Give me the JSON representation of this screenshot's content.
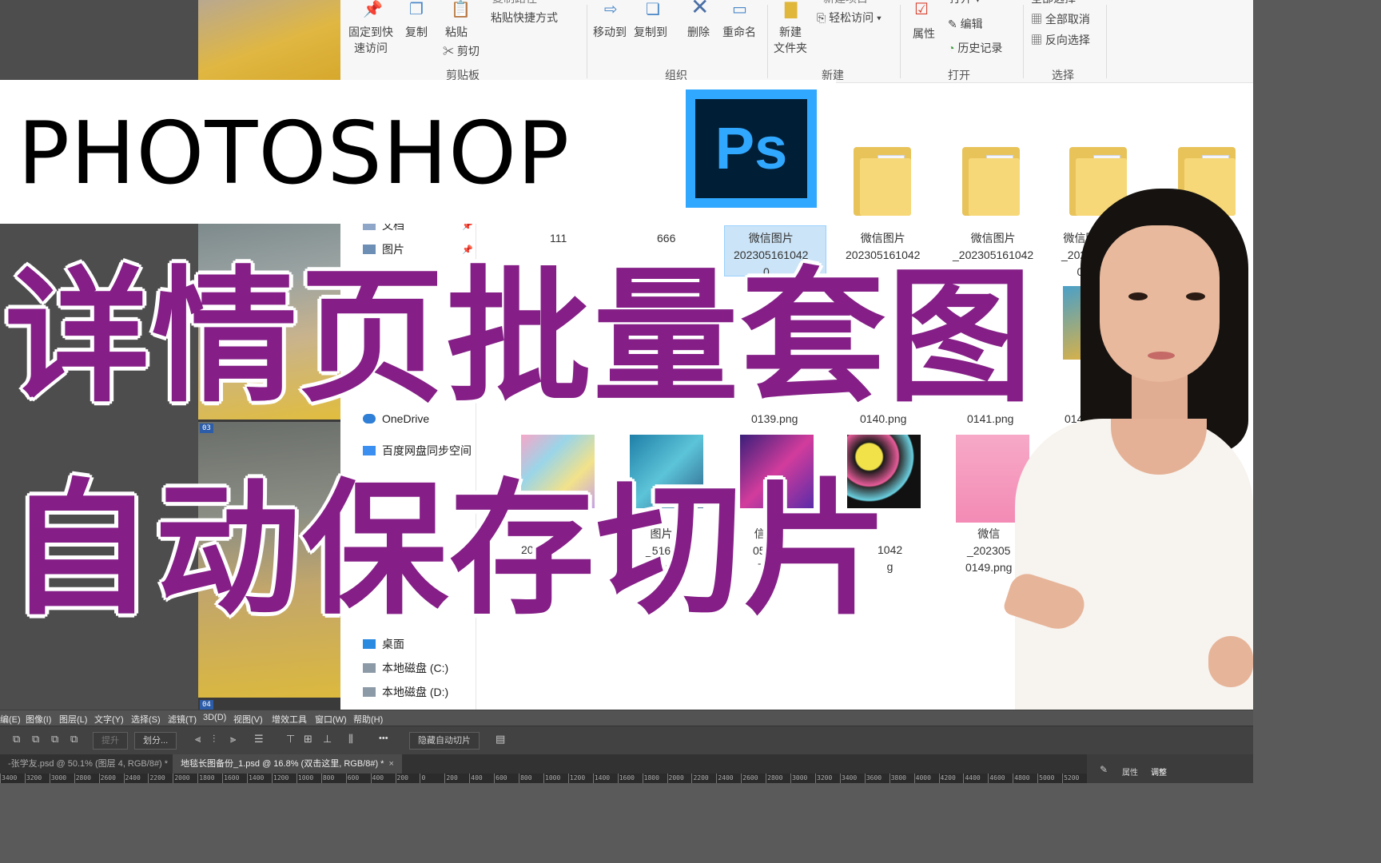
{
  "overlay": {
    "title_en": "PHOTOSHOP",
    "ps_logo": "Ps",
    "line1": "详情页批量套图",
    "line2": "自动保存切片"
  },
  "ribbon": {
    "pin_quick_access": "固定到快\n速访问",
    "copy": "复制",
    "paste": "粘贴",
    "copy_path": "复制路径",
    "paste_shortcut": "粘贴快捷方式",
    "cut": "剪切",
    "move_to": "移动到",
    "copy_to": "复制到",
    "delete": "删除",
    "rename": "重命名",
    "new_folder": "新建\n文件夹",
    "new_item": "新建项目",
    "easy_access": "轻松访问 ▾",
    "properties": "属性",
    "open": "打开 ▾",
    "edit": "编辑",
    "history": "历史记录",
    "select_all": "全部选择",
    "select_none": "全部取消",
    "invert_selection": "反向选择",
    "groups": {
      "clipboard": "剪贴板",
      "organize": "组织",
      "new": "新建",
      "open": "打开",
      "select": "选择"
    }
  },
  "nav": {
    "documents": "文档",
    "pictures": "图片",
    "onedrive": "OneDrive",
    "baidu": "百度网盘同步空间",
    "desktop": "桌面",
    "disk_c": "本地磁盘 (C:)",
    "disk_d": "本地磁盘 (D:)"
  },
  "files": {
    "row1": [
      {
        "name": "111"
      },
      {
        "name": "666"
      },
      {
        "name": "微信图片\n202305161042\n0..."
      },
      {
        "name": "微信图片\n202305161042"
      },
      {
        "name": "微信图片\n_202305161042"
      },
      {
        "name": "微信图\n_20230\n0"
      }
    ],
    "row2": [
      "0139.png",
      "0140.png",
      "0141.png",
      "014"
    ],
    "row3": [
      {
        "name": "2023"
      },
      {
        "name": "图片\n_5161\n5.png"
      },
      {
        "name": "信图\n0516\n7.p"
      },
      {
        "name": "1042\ng"
      },
      {
        "name": "微信\n_202305\n0149.png"
      }
    ]
  },
  "thumb_tags": [
    "03",
    "04"
  ],
  "ps": {
    "menu": [
      "编(E)",
      "图像(I)",
      "图层(L)",
      "文字(Y)",
      "选择(S)",
      "滤镜(T)",
      "3D(D)",
      "视图(V)",
      "增效工具",
      "窗口(W)",
      "帮助(H)"
    ],
    "options": {
      "promote": "提升",
      "divide": "划分...",
      "more": "•••",
      "hide_auto_slices": "隐藏自动切片"
    },
    "tabs": [
      {
        "label": "-张学友.psd @ 50.1% (图层 4, RGB/8#) *"
      },
      {
        "label": "地毯长图备份_1.psd @ 16.8% (双击这里, RGB/8#) *"
      }
    ],
    "ruler": [
      "3400",
      "3200",
      "3000",
      "2800",
      "2600",
      "2400",
      "2200",
      "2000",
      "1800",
      "1600",
      "1400",
      "1200",
      "1000",
      "800",
      "600",
      "400",
      "200",
      "0",
      "200",
      "400",
      "600",
      "800",
      "1000",
      "1200",
      "1400",
      "1600",
      "1800",
      "2000",
      "2200",
      "2400",
      "2600",
      "2800",
      "3000",
      "3200",
      "3400",
      "3600",
      "3800",
      "4000",
      "4200",
      "4400",
      "4600",
      "4800",
      "5000",
      "5200"
    ],
    "panel_tabs": [
      "属性",
      "调整"
    ]
  },
  "colors": {
    "headline_purple": "#851f87",
    "ps_blue": "#31a8ff",
    "ps_dark": "#001e36"
  }
}
